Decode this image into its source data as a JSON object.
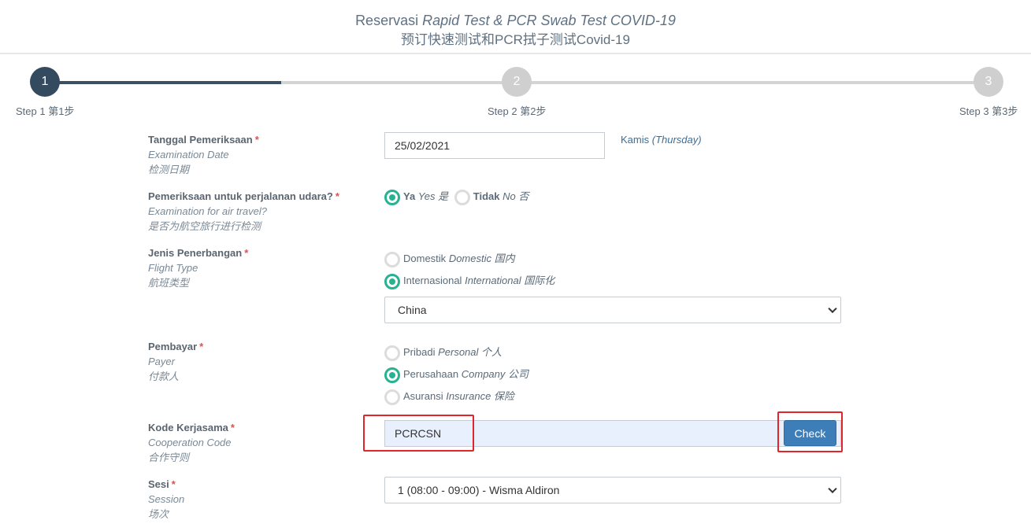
{
  "header": {
    "title_prefix": "Reservasi",
    "title_italic": "Rapid Test & PCR Swab Test COVID-19",
    "title_cn": "预订快速测试和PCR拭子测试Covid-19"
  },
  "steps": [
    {
      "number": "1",
      "label": "Step 1 第1步",
      "state": "active"
    },
    {
      "number": "2",
      "label": "Step 2 第2步",
      "state": "inactive"
    },
    {
      "number": "3",
      "label": "Step 3 第3步",
      "state": "inactive"
    }
  ],
  "progress_fraction": 0.25,
  "colors": {
    "accent_teal": "#27b393",
    "step_active": "#344a5e",
    "button_blue": "#3d7eb9",
    "highlight_red": "#e0262b",
    "required_red": "#d9534f"
  },
  "form": {
    "exam_date": {
      "label": "Tanggal Pemeriksaan",
      "required": "*",
      "label_en": "Examination Date",
      "label_cn": "检测日期",
      "value": "25/02/2021",
      "day_id": "Kamis",
      "day_en": "(Thursday)"
    },
    "air_travel": {
      "label": "Pemeriksaan untuk perjalanan udara?",
      "required": "*",
      "label_en": "Examination for air travel?",
      "label_cn": "是否为航空旅行进行检测",
      "options": [
        {
          "id": "Ya",
          "en": "Yes",
          "cn": "是",
          "selected": true
        },
        {
          "id": "Tidak",
          "en": "No",
          "cn": "否",
          "selected": false
        }
      ]
    },
    "flight_type": {
      "label": "Jenis Penerbangan",
      "required": "*",
      "label_en": "Flight Type",
      "label_cn": "航班类型",
      "options": [
        {
          "id": "Domestik",
          "en": "Domestic",
          "cn": "国内",
          "selected": false
        },
        {
          "id": "Internasional",
          "en": "International",
          "cn": "国际化",
          "selected": true
        }
      ],
      "country_selected": "China"
    },
    "payer": {
      "label": "Pembayar",
      "required": "*",
      "label_en": "Payer",
      "label_cn": "付款人",
      "options": [
        {
          "id": "Pribadi",
          "en": "Personal",
          "cn": "个人",
          "selected": false
        },
        {
          "id": "Perusahaan",
          "en": "Company",
          "cn": "公司",
          "selected": true
        },
        {
          "id": "Asuransi",
          "en": "Insurance",
          "cn": "保险",
          "selected": false
        }
      ]
    },
    "coop_code": {
      "label": "Kode Kerjasama",
      "required": "*",
      "label_en": "Cooperation Code",
      "label_cn": "合作守则",
      "value": "PCRCSN",
      "button": "Check"
    },
    "session": {
      "label": "Sesi",
      "required": "*",
      "label_en": "Session",
      "label_cn": "场次",
      "selected": "1 (08:00 - 09:00) - Wisma Aldiron"
    }
  }
}
